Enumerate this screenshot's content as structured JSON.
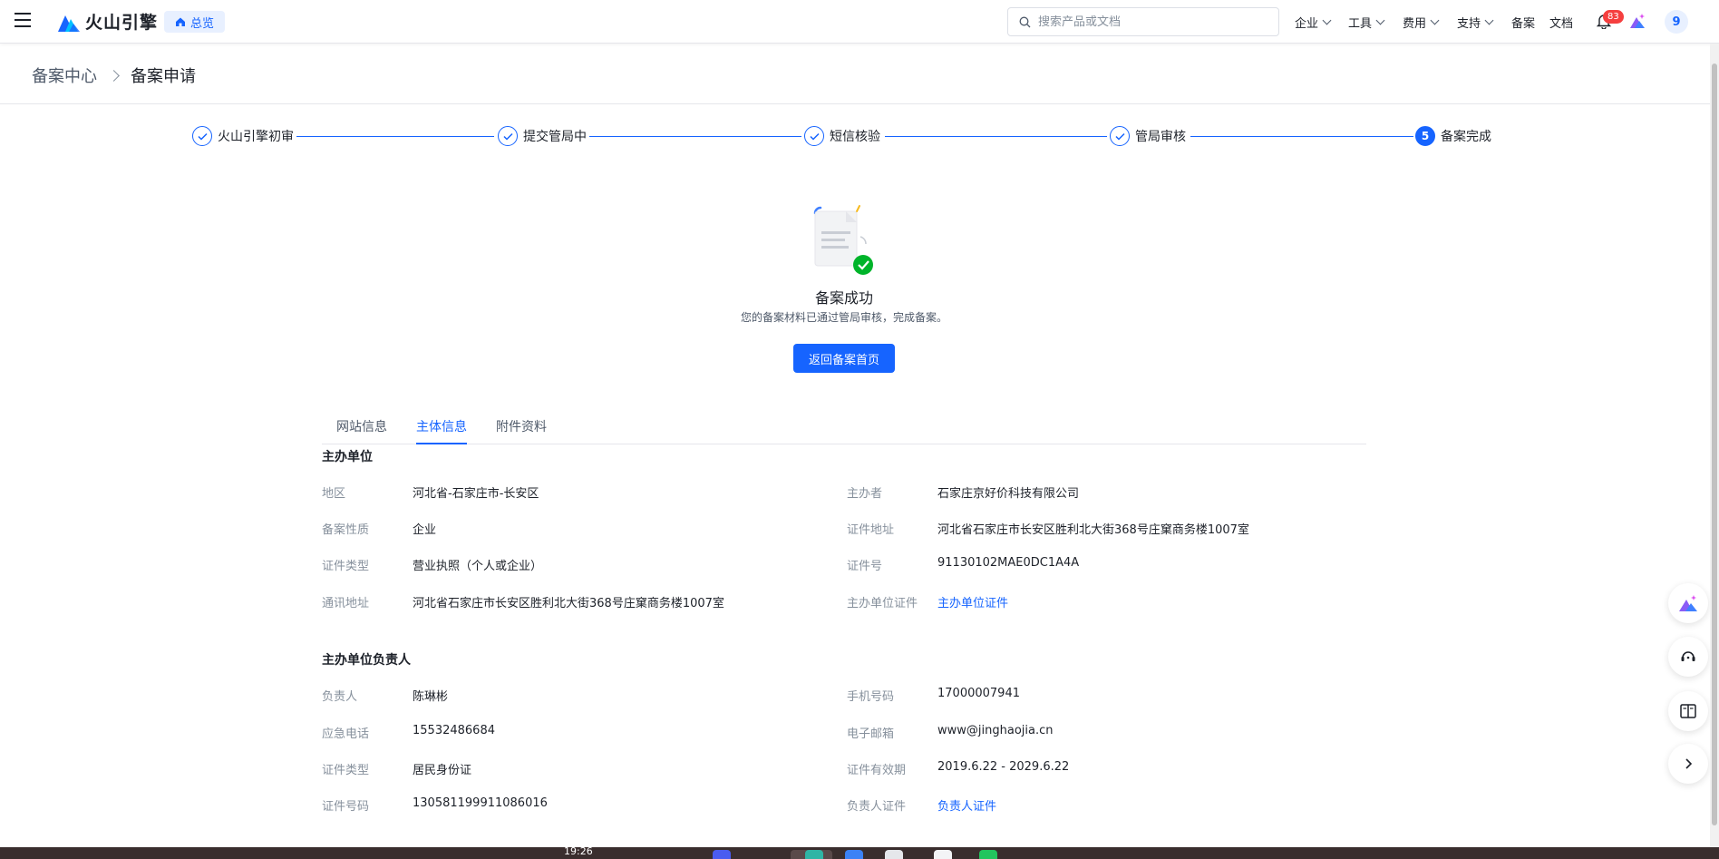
{
  "header": {
    "logo_text": "火山引擎",
    "overview_label": "总览",
    "search_placeholder": "搜索产品或文档",
    "nav": [
      {
        "label": "企业",
        "dropdown": true
      },
      {
        "label": "工具",
        "dropdown": true
      },
      {
        "label": "费用",
        "dropdown": true
      },
      {
        "label": "支持",
        "dropdown": true
      },
      {
        "label": "备案",
        "dropdown": false
      },
      {
        "label": "文档",
        "dropdown": false
      }
    ],
    "notification_count": "83",
    "avatar_text": "9"
  },
  "breadcrumb": {
    "parent": "备案中心",
    "current": "备案申请"
  },
  "steps": [
    {
      "label": "火山引擎初审",
      "status": "done"
    },
    {
      "label": "提交管局中",
      "status": "done"
    },
    {
      "label": "短信核验",
      "status": "done"
    },
    {
      "label": "管局审核",
      "status": "done"
    },
    {
      "label": "备案完成",
      "status": "current",
      "number": "5"
    }
  ],
  "result": {
    "title": "备案成功",
    "description": "您的备案材料已通过管局审核，完成备案。",
    "button_label": "返回备案首页"
  },
  "tabs": [
    {
      "label": "网站信息",
      "active": false
    },
    {
      "label": "主体信息",
      "active": true
    },
    {
      "label": "附件资料",
      "active": false
    }
  ],
  "sponsor": {
    "section_title": "主办单位",
    "fields": [
      {
        "label": "地区",
        "value": "河北省-石家庄市-长安区"
      },
      {
        "label": "主办者",
        "value": "石家庄京好价科技有限公司"
      },
      {
        "label": "备案性质",
        "value": "企业"
      },
      {
        "label": "证件地址",
        "value": "河北省石家庄市长安区胜利北大街368号庄窠商务楼1007室"
      },
      {
        "label": "证件类型",
        "value": "营业执照（个人或企业）"
      },
      {
        "label": "证件号",
        "value": "91130102MAE0DC1A4A"
      },
      {
        "label": "通讯地址",
        "value": "河北省石家庄市长安区胜利北大街368号庄窠商务楼1007室"
      },
      {
        "label": "主办单位证件",
        "value": "主办单位证件"
      }
    ]
  },
  "principal": {
    "section_title": "主办单位负责人",
    "fields": [
      {
        "label": "负责人",
        "value": "陈琳彬"
      },
      {
        "label": "手机号码",
        "value": "17000007941"
      },
      {
        "label": "应急电话",
        "value": "15532486684"
      },
      {
        "label": "电子邮箱",
        "value": "www@jinghaojia.cn"
      },
      {
        "label": "证件类型",
        "value": "居民身份证"
      },
      {
        "label": "证件有效期",
        "value": "2019.6.22 - 2029.6.22"
      },
      {
        "label": "证件号码",
        "value": "130581199911086016"
      },
      {
        "label": "负责人证件",
        "value": "负责人证件"
      }
    ]
  },
  "taskbar": {
    "time": "19:26"
  },
  "colors": {
    "primary": "#1664ff",
    "label": "#86909c",
    "text": "#1d2129"
  }
}
